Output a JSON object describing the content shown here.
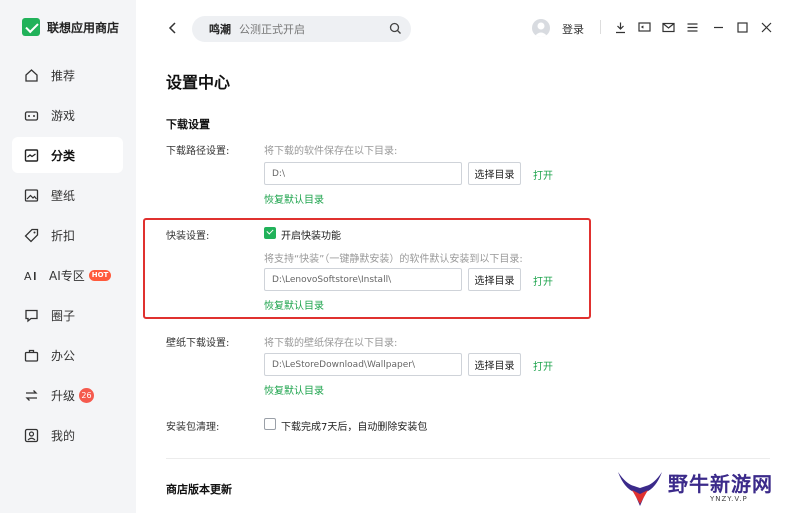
{
  "app": {
    "name": "联想应用商店"
  },
  "sidebar": {
    "items": [
      {
        "label": "推荐",
        "icon": "home-icon"
      },
      {
        "label": "游戏",
        "icon": "gamepad-icon"
      },
      {
        "label": "分类",
        "icon": "category-icon",
        "active": true
      },
      {
        "label": "壁纸",
        "icon": "image-icon"
      },
      {
        "label": "折扣",
        "icon": "tag-icon"
      },
      {
        "label": "AI专区",
        "icon": "ai-icon",
        "tag": "HOT"
      },
      {
        "label": "圈子",
        "icon": "chat-icon"
      },
      {
        "label": "办公",
        "icon": "briefcase-icon"
      },
      {
        "label": "升级",
        "icon": "update-icon",
        "badge": "26"
      },
      {
        "label": "我的",
        "icon": "user-icon"
      }
    ]
  },
  "topbar": {
    "search_hot": "鸣潮",
    "search_placeholder": "公测正式开启",
    "login_label": "登录"
  },
  "main": {
    "title": "设置中心",
    "download_section": "下载设置",
    "download_path": {
      "label": "下载路径设置:",
      "hint": "将下载的软件保存在以下目录:",
      "value": "D:\\",
      "choose_label": "选择目录",
      "open_label": "打开",
      "restore_label": "恢复默认目录"
    },
    "quick_install": {
      "label": "快装设置:",
      "checkbox_label": "开启快装功能",
      "checked": true,
      "hint": "将支持“快装”（一键静默安装）的软件默认安装到以下目录:",
      "value": "D:\\LenovoSoftstore\\Install\\",
      "choose_label": "选择目录",
      "open_label": "打开",
      "restore_label": "恢复默认目录"
    },
    "wallpaper": {
      "label": "壁纸下载设置:",
      "hint": "将下载的壁纸保存在以下目录:",
      "value": "D:\\LeStoreDownload\\Wallpaper\\",
      "choose_label": "选择目录",
      "open_label": "打开",
      "restore_label": "恢复默认目录"
    },
    "cleanup": {
      "label": "安装包清理:",
      "checkbox_label": "下载完成7天后，自动删除安装包",
      "checked": false
    },
    "store_update_section": "商店版本更新"
  },
  "watermark": {
    "text": "野牛新游网",
    "sub": "YNZY.V.P"
  },
  "colors": {
    "accent": "#21b25a",
    "highlight": "#e0312f"
  }
}
